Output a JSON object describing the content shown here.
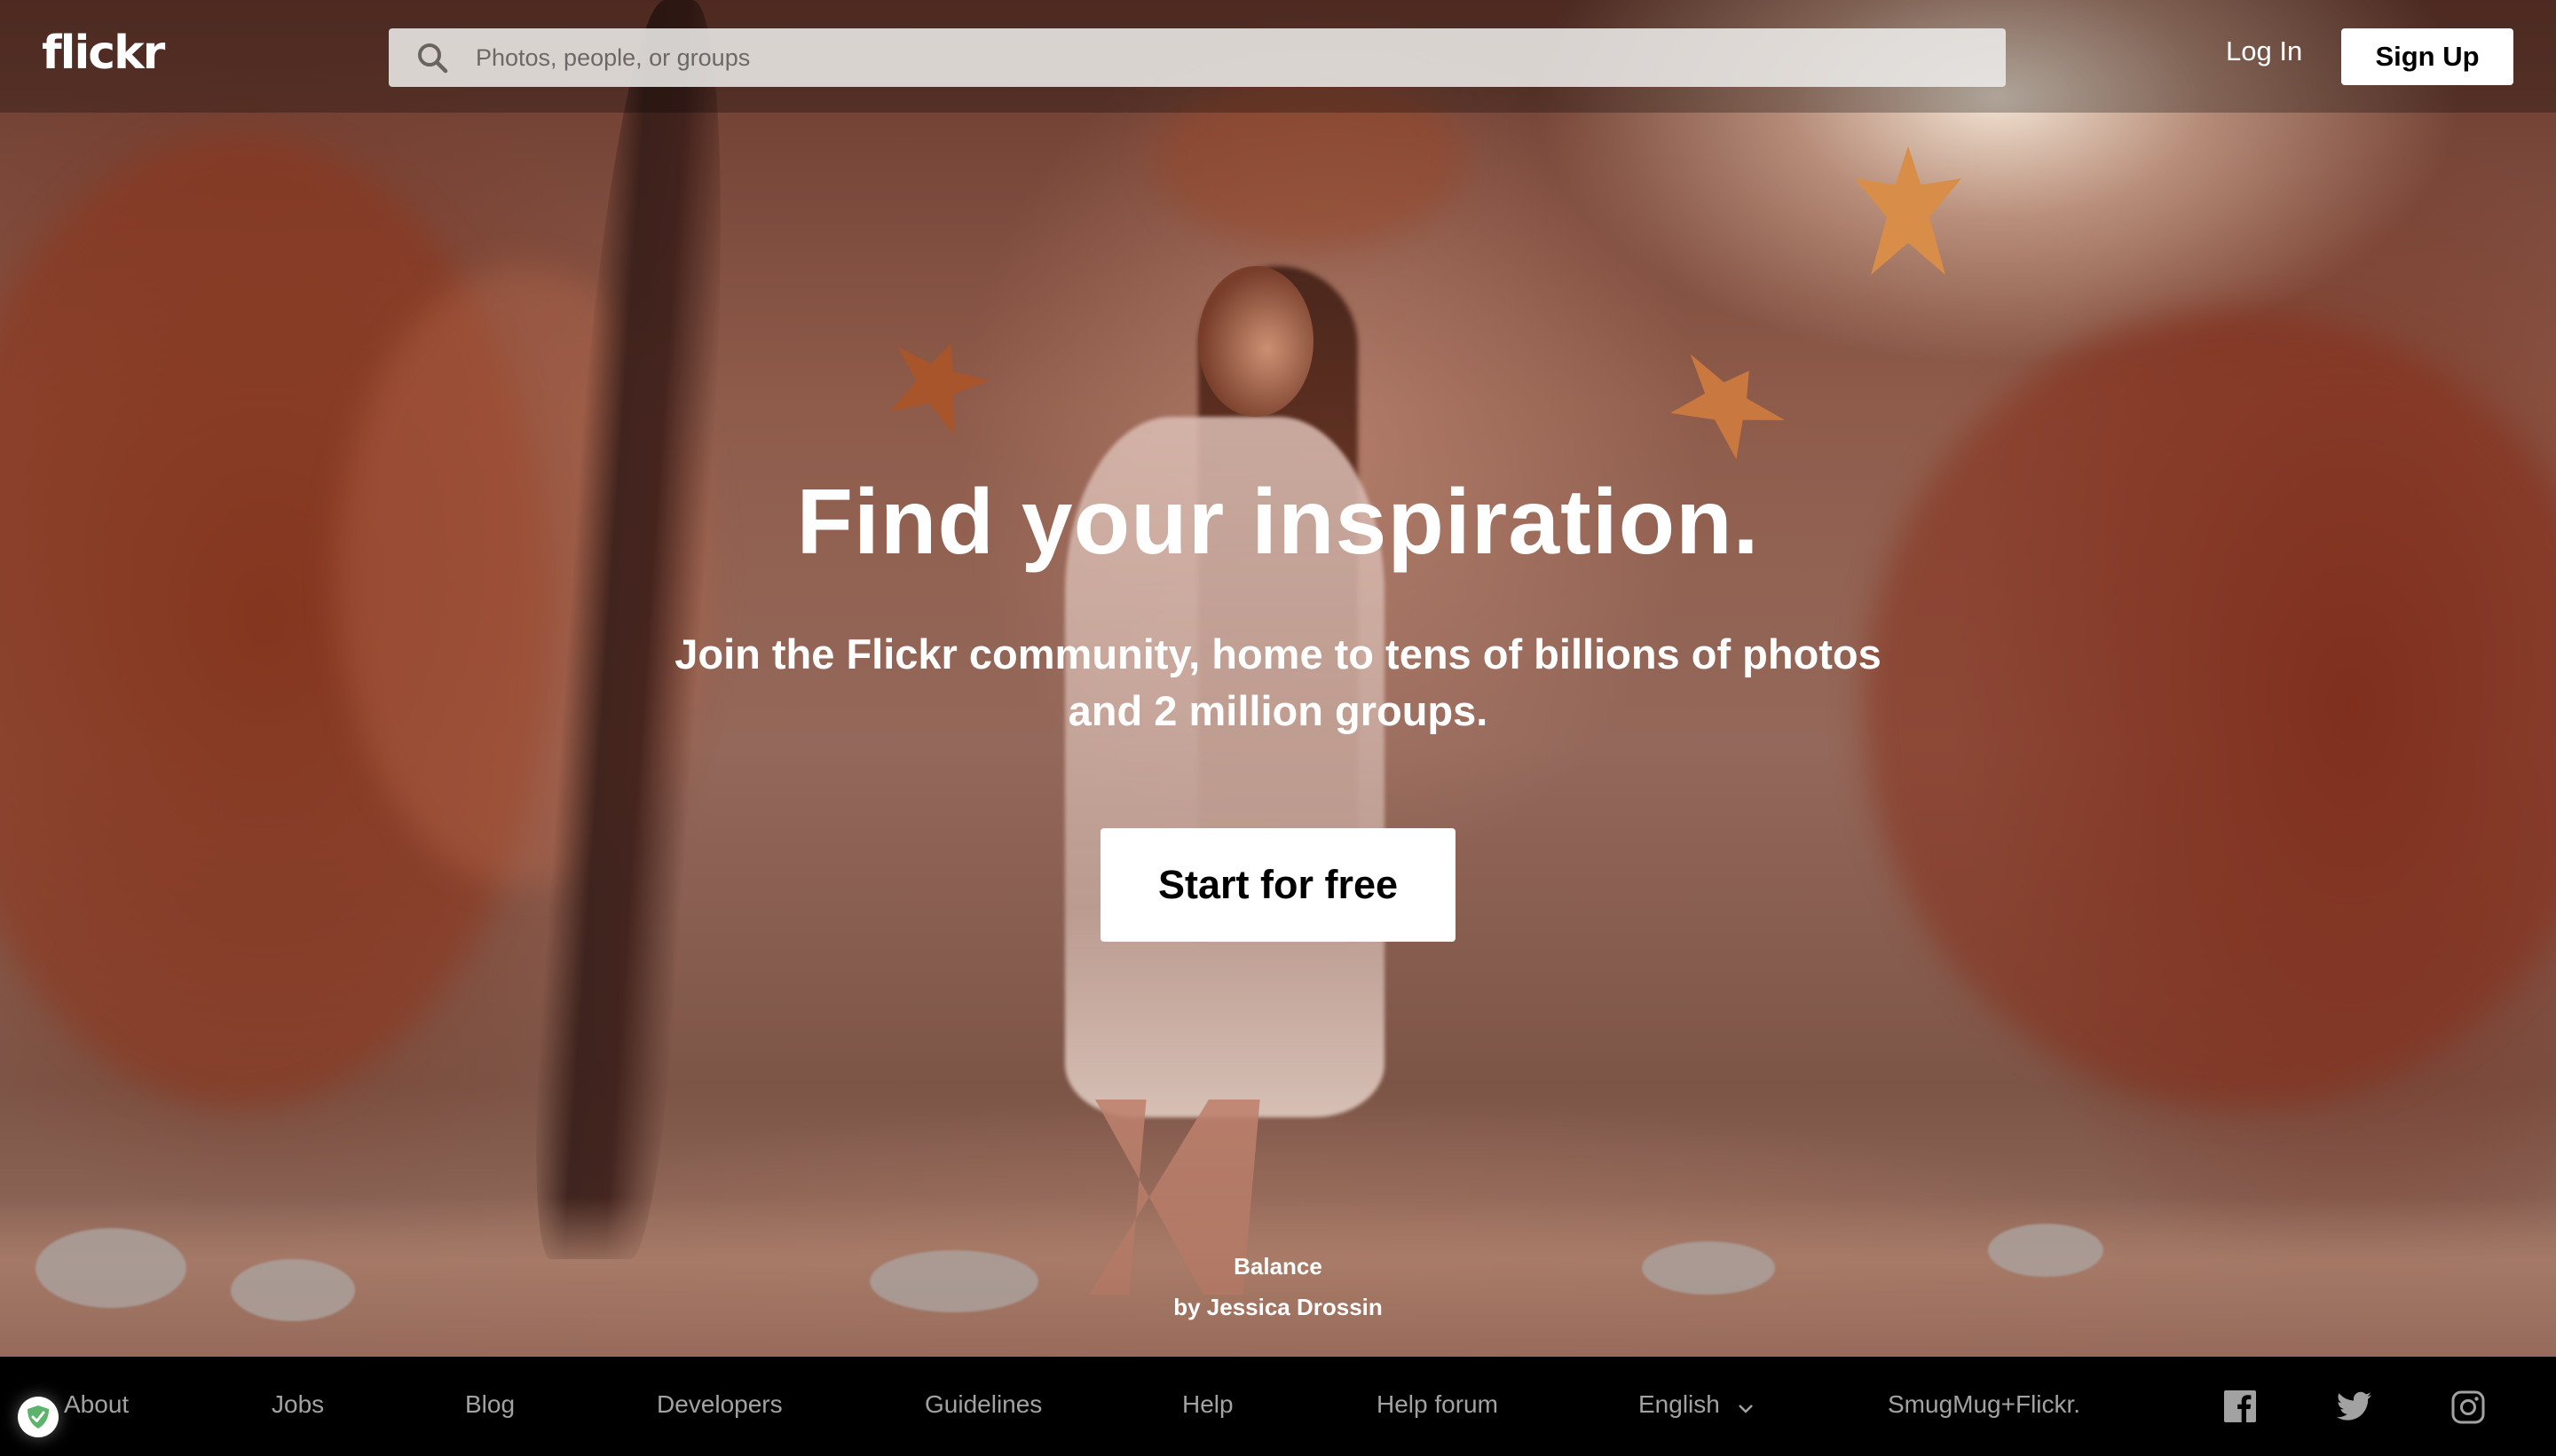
{
  "header": {
    "logo": "flickr",
    "search": {
      "placeholder": "Photos, people, or groups",
      "value": "",
      "icon": "search-icon"
    },
    "login_label": "Log In",
    "signup_label": "Sign Up"
  },
  "hero": {
    "headline": "Find your inspiration.",
    "subline": "Join the Flickr community, home to tens of billions of photos and 2 million groups.",
    "cta_label": "Start for free",
    "photo_credit": {
      "title": "Balance",
      "author": "by Jessica Drossin"
    }
  },
  "footer": {
    "links": [
      {
        "label": "About"
      },
      {
        "label": "Jobs"
      },
      {
        "label": "Blog"
      },
      {
        "label": "Developers"
      },
      {
        "label": "Guidelines"
      },
      {
        "label": "Help"
      },
      {
        "label": "Help forum"
      }
    ],
    "language": {
      "selected": "English",
      "icon": "chevron-down-icon"
    },
    "brand": "SmugMug+Flickr.",
    "social": [
      {
        "name": "facebook",
        "icon": "facebook-icon"
      },
      {
        "name": "twitter",
        "icon": "twitter-icon"
      },
      {
        "name": "instagram",
        "icon": "instagram-icon"
      }
    ]
  },
  "extension_badge": {
    "icon": "shield-check-icon",
    "color": "#5cb36b"
  },
  "colors": {
    "header_overlay": "rgba(0,0,0,0.28)",
    "button_bg": "#ffffff",
    "button_text": "#000000",
    "footer_bg": "#000000",
    "footer_text": "#a2a2a2"
  }
}
